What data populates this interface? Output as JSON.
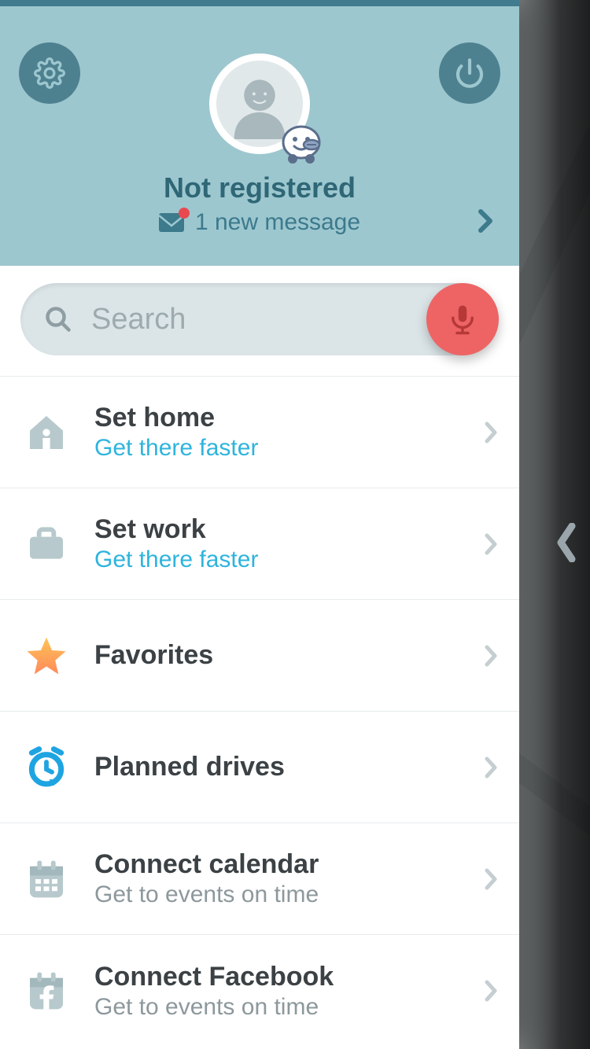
{
  "header": {
    "status": "Not registered",
    "messages_label": "1 new message"
  },
  "search": {
    "placeholder": "Search"
  },
  "items": [
    {
      "title": "Set home",
      "subtitle": "Get there faster",
      "subtitle_style": "accent"
    },
    {
      "title": "Set work",
      "subtitle": "Get there faster",
      "subtitle_style": "accent"
    },
    {
      "title": "Favorites",
      "subtitle": "",
      "subtitle_style": ""
    },
    {
      "title": "Planned drives",
      "subtitle": "",
      "subtitle_style": ""
    },
    {
      "title": "Connect calendar",
      "subtitle": "Get to events on time",
      "subtitle_style": "muted"
    },
    {
      "title": "Connect Facebook",
      "subtitle": "Get to events on time",
      "subtitle_style": "muted"
    }
  ]
}
